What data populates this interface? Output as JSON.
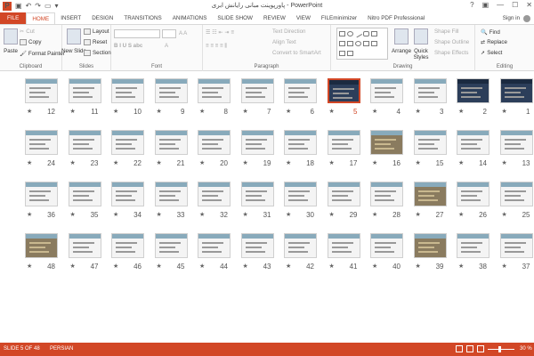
{
  "window": {
    "title": "پاورپوینت مبانی رایانش ابری - PowerPoint",
    "signin": "Sign in"
  },
  "ribbon_tabs": [
    "FILE",
    "HOME",
    "INSERT",
    "DESIGN",
    "TRANSITIONS",
    "ANIMATIONS",
    "SLIDE SHOW",
    "REVIEW",
    "VIEW",
    "FILEminimizer",
    "Nitro PDF Professional"
  ],
  "active_tab": "HOME",
  "clipboard": {
    "paste": "Paste",
    "cut": "Cut",
    "copy": "Copy",
    "format_painter": "Format Painter",
    "label": "Clipboard"
  },
  "slides_group": {
    "new_slide": "New Slide",
    "layout": "Layout",
    "reset": "Reset",
    "section": "Section",
    "label": "Slides"
  },
  "font_group": {
    "label": "Font"
  },
  "paragraph_group": {
    "text_direction": "Text Direction",
    "align_text": "Align Text",
    "convert_smartart": "Convert to SmartArt",
    "label": "Paragraph"
  },
  "drawing_group": {
    "arrange": "Arrange",
    "quick_styles": "Quick Styles",
    "shape_fill": "Shape Fill",
    "shape_outline": "Shape Outline",
    "shape_effects": "Shape Effects",
    "label": "Drawing"
  },
  "editing_group": {
    "find": "Find",
    "replace": "Replace",
    "select": "Select",
    "label": "Editing"
  },
  "slides": [
    {
      "num": "1",
      "style": "dark"
    },
    {
      "num": "2",
      "style": "dark"
    },
    {
      "num": "3",
      "style": "light"
    },
    {
      "num": "4",
      "style": "light"
    },
    {
      "num": "5",
      "style": "dark",
      "selected": true
    },
    {
      "num": "6",
      "style": "light"
    },
    {
      "num": "7",
      "style": "light"
    },
    {
      "num": "8",
      "style": "light"
    },
    {
      "num": "9",
      "style": "light"
    },
    {
      "num": "10",
      "style": "light"
    },
    {
      "num": "11",
      "style": "light"
    },
    {
      "num": "12",
      "style": "light"
    },
    {
      "num": "13",
      "style": "light"
    },
    {
      "num": "14",
      "style": "light"
    },
    {
      "num": "15",
      "style": "light"
    },
    {
      "num": "16",
      "style": "photo"
    },
    {
      "num": "17",
      "style": "light"
    },
    {
      "num": "18",
      "style": "light"
    },
    {
      "num": "19",
      "style": "light"
    },
    {
      "num": "20",
      "style": "light"
    },
    {
      "num": "21",
      "style": "light"
    },
    {
      "num": "22",
      "style": "light"
    },
    {
      "num": "23",
      "style": "light"
    },
    {
      "num": "24",
      "style": "light"
    },
    {
      "num": "25",
      "style": "light"
    },
    {
      "num": "26",
      "style": "light"
    },
    {
      "num": "27",
      "style": "photo"
    },
    {
      "num": "28",
      "style": "light"
    },
    {
      "num": "29",
      "style": "light"
    },
    {
      "num": "30",
      "style": "light"
    },
    {
      "num": "31",
      "style": "light"
    },
    {
      "num": "32",
      "style": "light"
    },
    {
      "num": "33",
      "style": "light"
    },
    {
      "num": "34",
      "style": "light"
    },
    {
      "num": "35",
      "style": "light"
    },
    {
      "num": "36",
      "style": "light"
    },
    {
      "num": "37",
      "style": "light"
    },
    {
      "num": "38",
      "style": "light"
    },
    {
      "num": "39",
      "style": "photo"
    },
    {
      "num": "40",
      "style": "light"
    },
    {
      "num": "41",
      "style": "light"
    },
    {
      "num": "42",
      "style": "light"
    },
    {
      "num": "43",
      "style": "light"
    },
    {
      "num": "44",
      "style": "light"
    },
    {
      "num": "45",
      "style": "light"
    },
    {
      "num": "46",
      "style": "light"
    },
    {
      "num": "47",
      "style": "light"
    },
    {
      "num": "48",
      "style": "photo"
    }
  ],
  "status": {
    "slide_info": "SLIDE 5 OF 48",
    "language": "PERSIAN",
    "zoom": "30 %"
  },
  "colors": {
    "accent": "#d24726"
  }
}
